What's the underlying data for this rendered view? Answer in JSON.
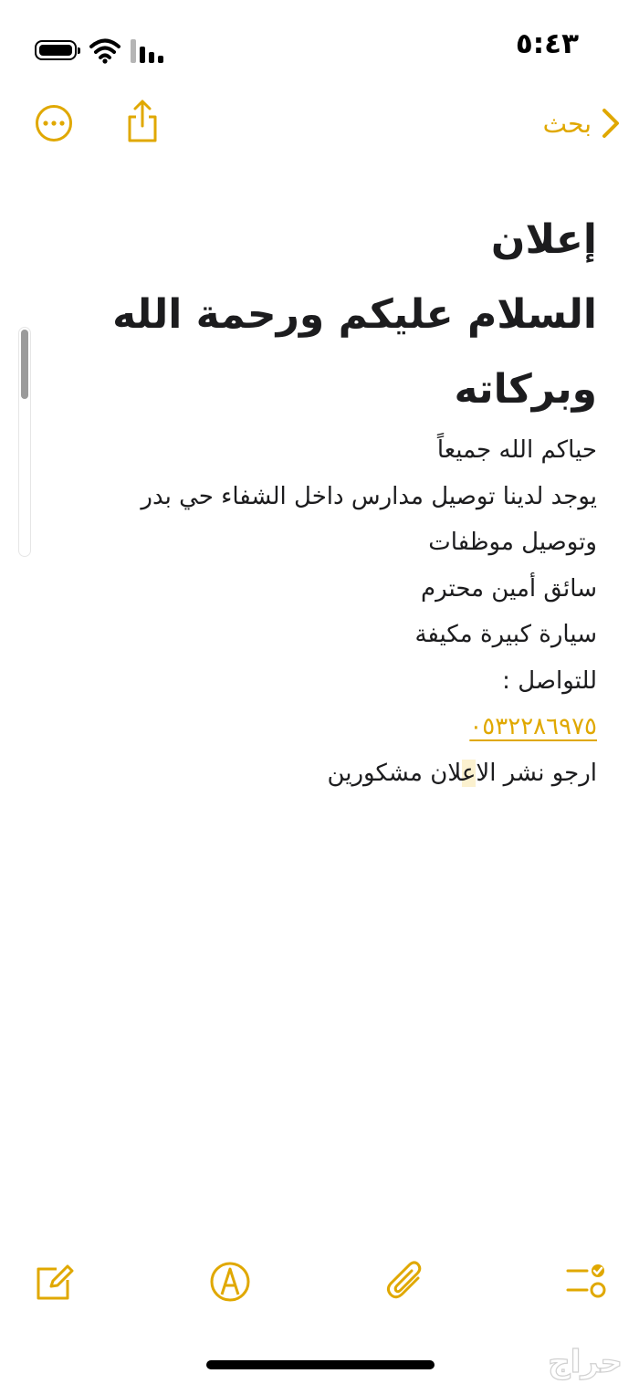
{
  "status_bar": {
    "time": "٥:٤٣"
  },
  "nav": {
    "back_label": "بحث",
    "back_icon": "chevron-right-icon",
    "more_icon": "ellipsis-circle-icon",
    "share_icon": "share-icon"
  },
  "note": {
    "title_lines": [
      "إعلان",
      "السلام عليكم ورحمة الله",
      "وبركاته"
    ],
    "body": {
      "line1": "حياكم الله جميعاً",
      "line2": "يوجد لدينا توصيل مدارس داخل الشفاء حي بدر",
      "line3": "وتوصيل موظفات",
      "line4": "سائق أمين محترم",
      "line5": "سيارة كبيرة مكيفة",
      "line6": "للتواصل :",
      "phone": "٠٥٣٢٢٨٦٩٧٥",
      "last_pre": "ارجو نشر ال",
      "last_hl": "اع",
      "last_post": "لان مشكورين"
    }
  },
  "toolbar": {
    "icons": [
      "compose-icon",
      "markup-pen-icon",
      "paperclip-icon",
      "checklist-icon"
    ]
  },
  "watermark": "حراج",
  "colors": {
    "accent": "#e0a800",
    "text": "#1c1c1e",
    "highlight": "#fbf1cf"
  }
}
